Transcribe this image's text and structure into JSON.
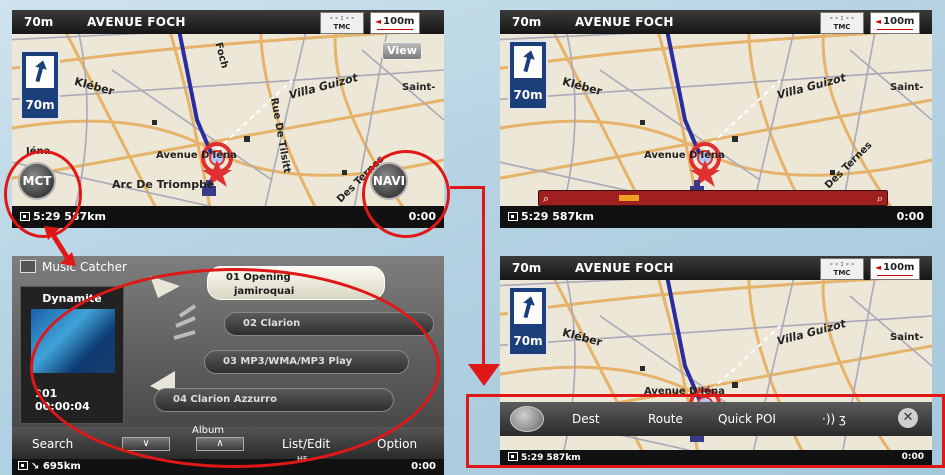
{
  "colors": {
    "accent_red": "#e01717",
    "map_bg": "#ece7d6",
    "bar_dark": "#1a1a1a"
  },
  "nav": {
    "dist": "70m",
    "street": "AVENUE FOCH",
    "tmc": "TMC",
    "scale": "100m",
    "turn_dist": "70m",
    "view": "View",
    "mct": "MCT",
    "navi": "NAVI",
    "eta": "5:29",
    "remaining": "587km",
    "time": "0:00",
    "streets": [
      "Foch",
      "Kléber",
      "Villa Guizot",
      "Saint-",
      "Avenue D'Iéna",
      "Arc De Triomphe",
      "Rue De Tilsitt",
      "Des Ternes",
      "Iéna"
    ]
  },
  "music": {
    "title": "Music Catcher",
    "album_name": "Dynamite",
    "track_no": "01",
    "track_time": "00:00:04",
    "songs": [
      {
        "label": "01 Opening",
        "sub": "jamiroquai"
      },
      {
        "label": "02 Clarion"
      },
      {
        "label": "03 MP3/WMA/MP3 Play"
      },
      {
        "label": "04 Clarion Azzurro"
      }
    ],
    "search": "Search",
    "album": "Album",
    "album_down": "∨",
    "album_up": "∧",
    "list_edit": "List/Edit",
    "option": "Option",
    "remaining": "695km",
    "hf": "HF",
    "time": "0:00"
  },
  "menu": {
    "dest": "Dest",
    "route": "Route",
    "quick_poi": "Quick POI",
    "voice": "·)) ʒ",
    "close": "✕"
  }
}
